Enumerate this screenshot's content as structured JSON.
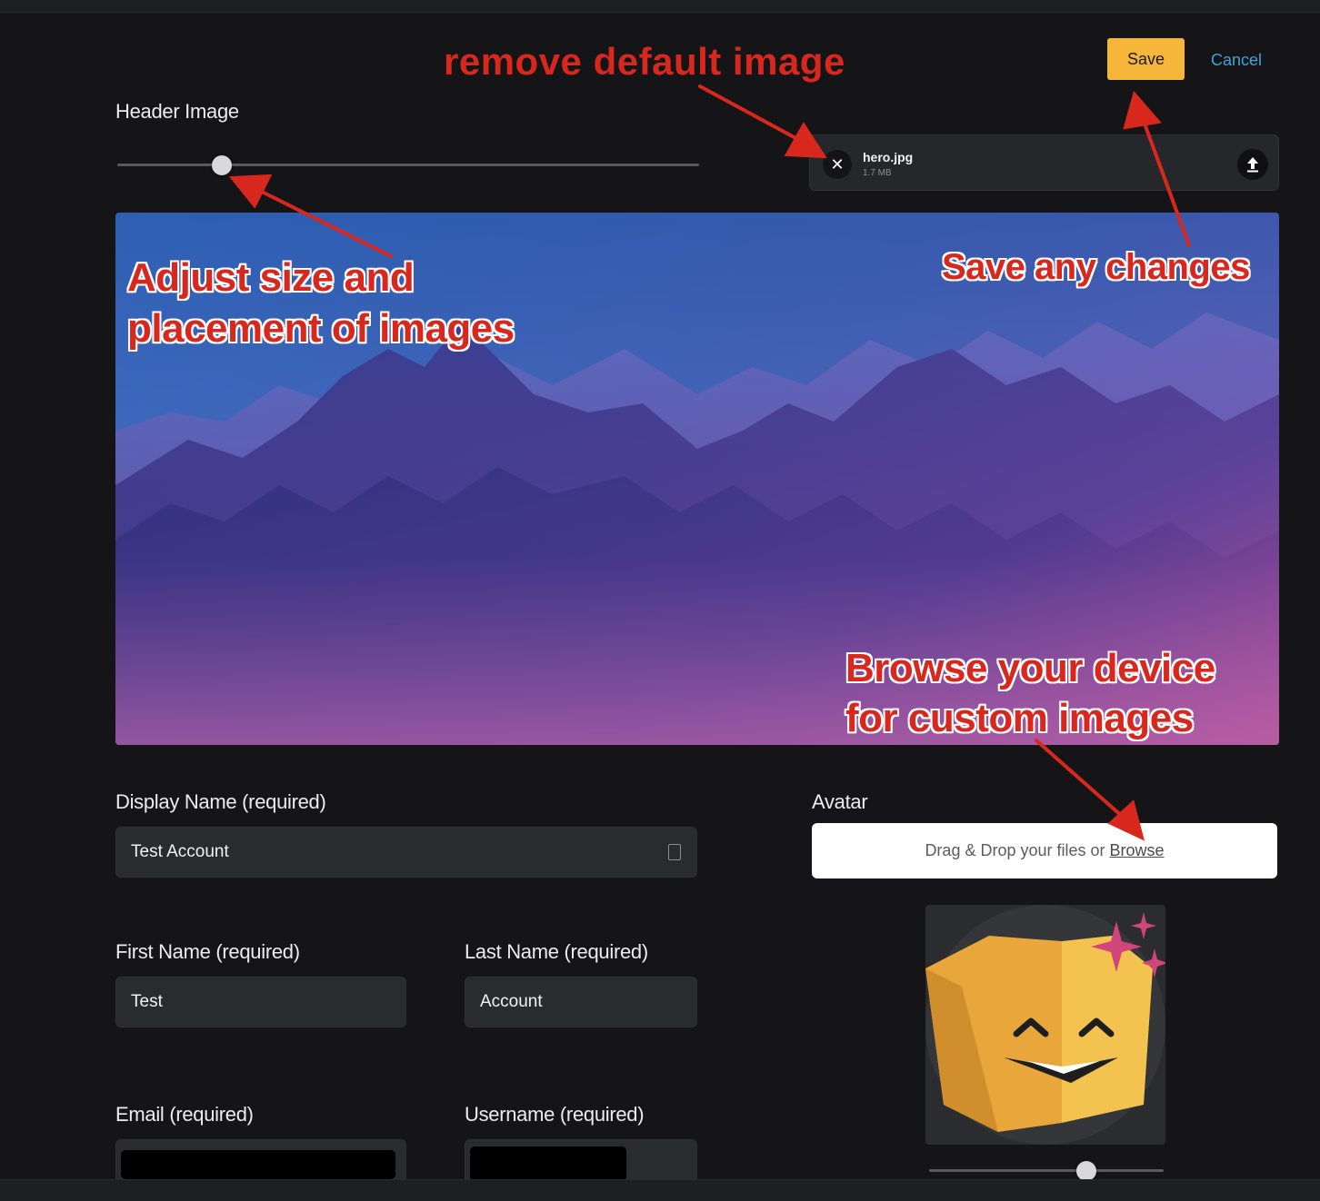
{
  "header_image": {
    "label": "Header Image",
    "file": {
      "name": "hero.jpg",
      "size": "1.7 MB"
    },
    "slider_value": 0.18
  },
  "actions": {
    "save_label": "Save",
    "cancel_label": "Cancel"
  },
  "form": {
    "display_name": {
      "label": "Display Name (required)",
      "value": "Test Account"
    },
    "first_name": {
      "label": "First Name (required)",
      "value": "Test"
    },
    "last_name": {
      "label": "Last Name (required)",
      "value": "Account"
    },
    "email": {
      "label": "Email (required)"
    },
    "username": {
      "label": "Username (required)"
    }
  },
  "avatar": {
    "label": "Avatar",
    "dropzone_text": "Drag & Drop your files or",
    "browse_label": "Browse",
    "slider_value": 0.67
  },
  "annotations": {
    "remove_default": "remove default image",
    "save_changes": "Save any changes",
    "adjust_line1": "Adjust size and",
    "adjust_line2": "placement of images",
    "browse_line1": "Browse your device",
    "browse_line2": "for custom images"
  },
  "colors": {
    "background": "#151517",
    "accent_save": "#f5b63a",
    "link_cancel": "#3fa3dc",
    "annotation_red": "#d8281e"
  }
}
